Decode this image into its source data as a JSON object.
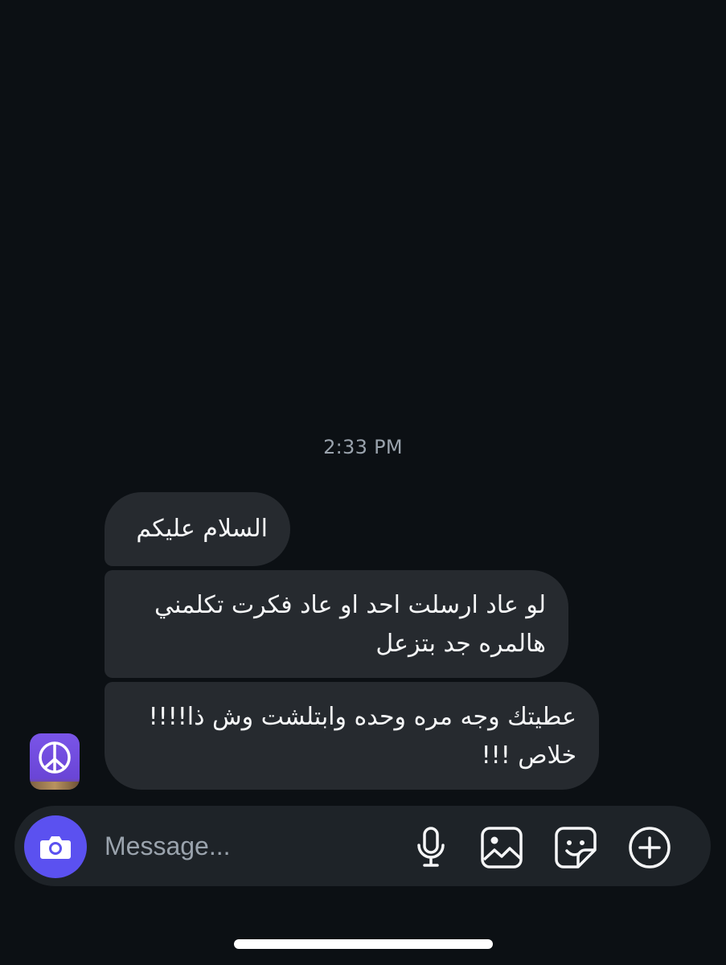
{
  "thread": {
    "timestamp": "2:33 PM",
    "messages": [
      {
        "text": "السلام عليكم"
      },
      {
        "text": "لو عاد ارسلت احد او عاد فكرت تكلمني هالمره جد بتزعل"
      },
      {
        "text": "عطيتك وجه مره وحده وابتلشت وش ذا!!!! خلاص !!!"
      }
    ]
  },
  "composer": {
    "placeholder": "Message...",
    "camera_icon": "camera-icon",
    "tools": [
      "microphone-icon",
      "gallery-icon",
      "sticker-icon",
      "plus-circle-icon"
    ],
    "accent_color": "#5b51f0"
  },
  "colors": {
    "background": "#0c1014",
    "bubble": "#262a2f",
    "composer": "#1e2328"
  }
}
